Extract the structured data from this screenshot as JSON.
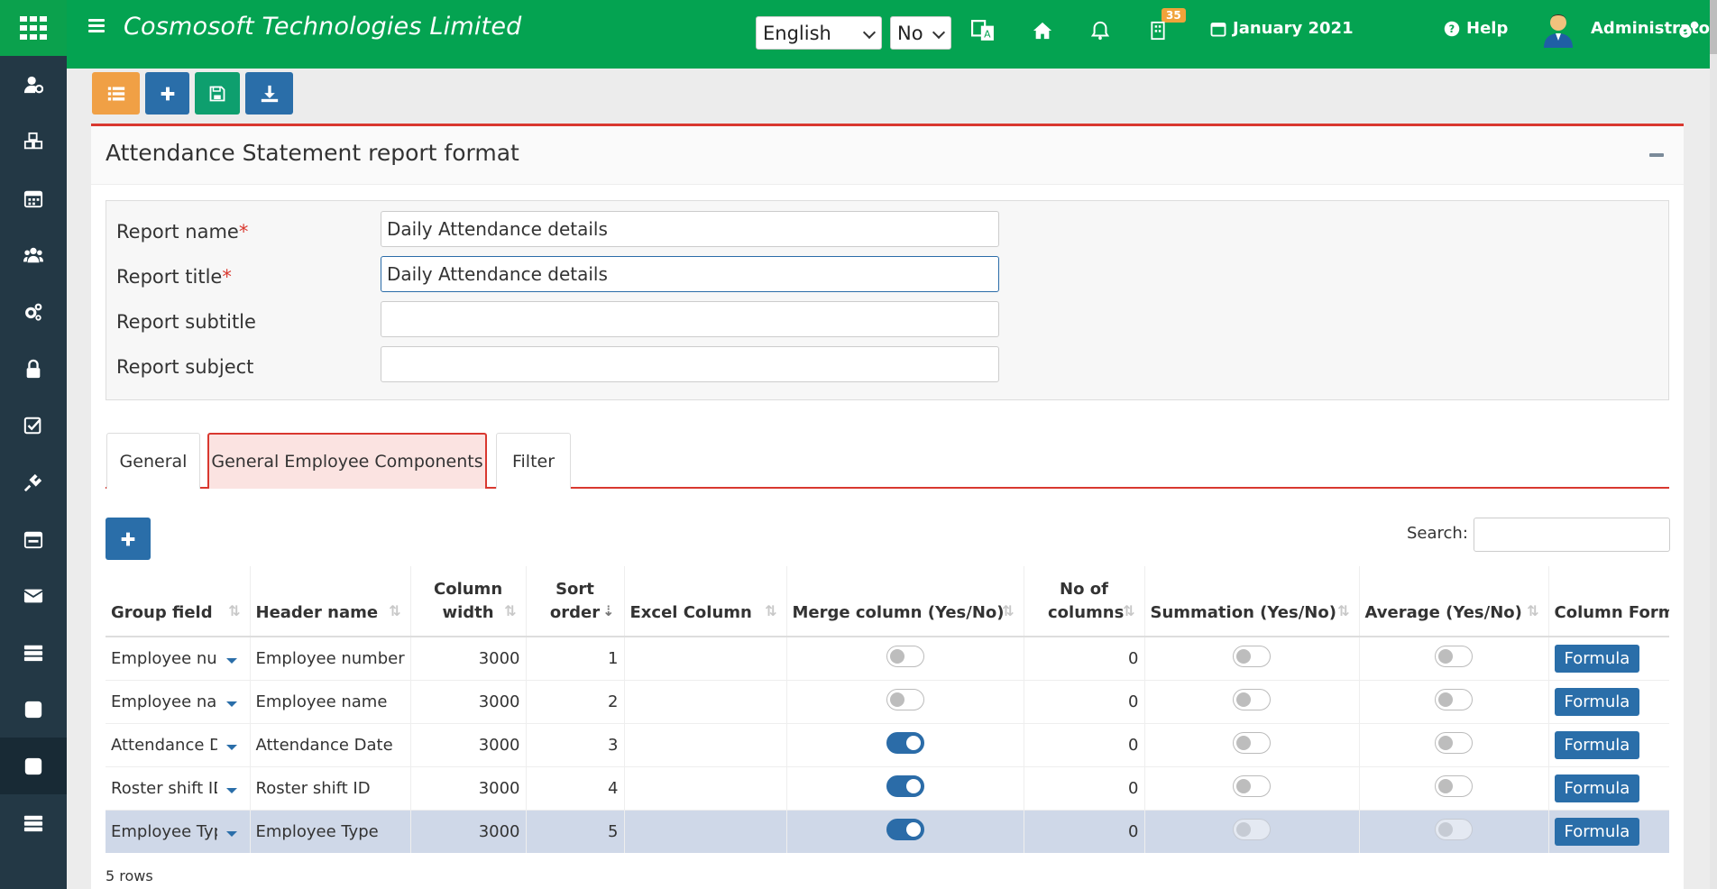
{
  "app": {
    "brand": "Cosmosoft Technologies Limited",
    "language": "English",
    "no_select": "No",
    "notification_count": "35",
    "period": "January 2021",
    "help": "Help",
    "user": "Administrator"
  },
  "colors": {
    "green": "#04a351",
    "sidebar": "#233845",
    "accent_red": "#d9382f",
    "blue": "#2a6ea9",
    "orange": "#f0a045"
  },
  "sidebar": {
    "icons": [
      "user-gear-icon",
      "cubes-icon",
      "calendar-icon",
      "users-icon",
      "gears-icon",
      "lock-icon",
      "checkbox-icon",
      "plug-icon",
      "calendar-check-icon",
      "envelope-icon",
      "server-icon",
      "square-icon",
      "square-active-icon",
      "server-stack-icon"
    ]
  },
  "panel": {
    "title": "Attendance Statement report format"
  },
  "form": {
    "report_name_label": "Report name",
    "report_name_value": "Daily Attendance details",
    "report_title_label": "Report title",
    "report_title_value": "Daily Attendance details",
    "report_subtitle_label": "Report subtitle",
    "report_subtitle_value": "",
    "report_subject_label": "Report subject",
    "report_subject_value": "",
    "required_mark": "*"
  },
  "tabs": {
    "general": "General",
    "employee_components": "General Employee Components",
    "filter": "Filter"
  },
  "table": {
    "search_label": "Search:",
    "headers": {
      "group_field": "Group field",
      "header_name": "Header name",
      "column_width": "Column width",
      "sort_order": "Sort order",
      "excel_column": "Excel Column",
      "merge_column": "Merge column (Yes/No)",
      "no_of_columns": "No of columns",
      "summation": "Summation (Yes/No)",
      "average": "Average (Yes/No)",
      "column_formula": "Column Formula"
    },
    "rows": [
      {
        "group_field": "Employee number",
        "header_name": "Employee number",
        "column_width": "3000",
        "sort_order": "1",
        "excel_column": "",
        "merge": false,
        "no_of_columns": "0",
        "summation": false,
        "average": false,
        "formula": "Formula"
      },
      {
        "group_field": "Employee name",
        "header_name": "Employee name",
        "column_width": "3000",
        "sort_order": "2",
        "excel_column": "",
        "merge": false,
        "no_of_columns": "0",
        "summation": false,
        "average": false,
        "formula": "Formula"
      },
      {
        "group_field": "Attendance Date",
        "header_name": "Attendance Date",
        "column_width": "3000",
        "sort_order": "3",
        "excel_column": "",
        "merge": true,
        "no_of_columns": "0",
        "summation": false,
        "average": false,
        "formula": "Formula"
      },
      {
        "group_field": "Roster shift ID",
        "header_name": "Roster shift ID",
        "column_width": "3000",
        "sort_order": "4",
        "excel_column": "",
        "merge": true,
        "no_of_columns": "0",
        "summation": false,
        "average": false,
        "formula": "Formula"
      },
      {
        "group_field": "Employee Type",
        "header_name": "Employee Type",
        "column_width": "3000",
        "sort_order": "5",
        "excel_column": "",
        "merge": true,
        "no_of_columns": "0",
        "summation": false,
        "average": false,
        "formula": "Formula"
      }
    ],
    "rows_count": "5 rows"
  }
}
